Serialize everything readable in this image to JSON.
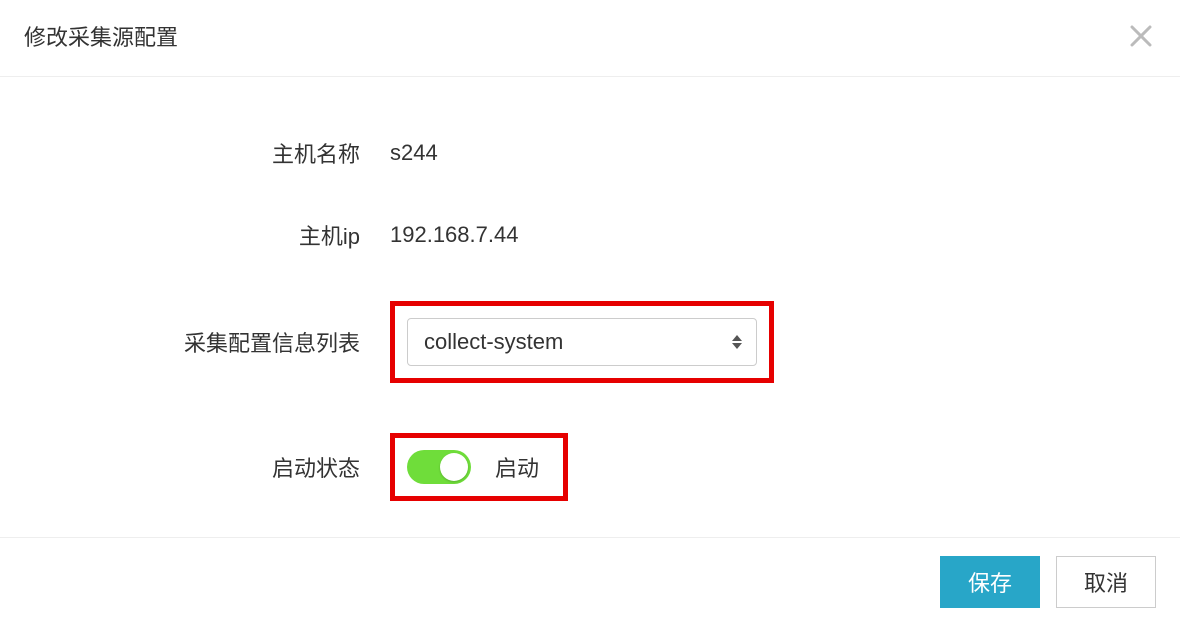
{
  "modal": {
    "title": "修改采集源配置",
    "fields": {
      "hostname_label": "主机名称",
      "hostname_value": "s244",
      "hostip_label": "主机ip",
      "hostip_value": "192.168.7.44",
      "config_list_label": "采集配置信息列表",
      "config_selected": "collect-system",
      "status_label": "启动状态",
      "status_toggle_on": true,
      "status_text": "启动"
    },
    "footer": {
      "save_label": "保存",
      "cancel_label": "取消"
    }
  }
}
